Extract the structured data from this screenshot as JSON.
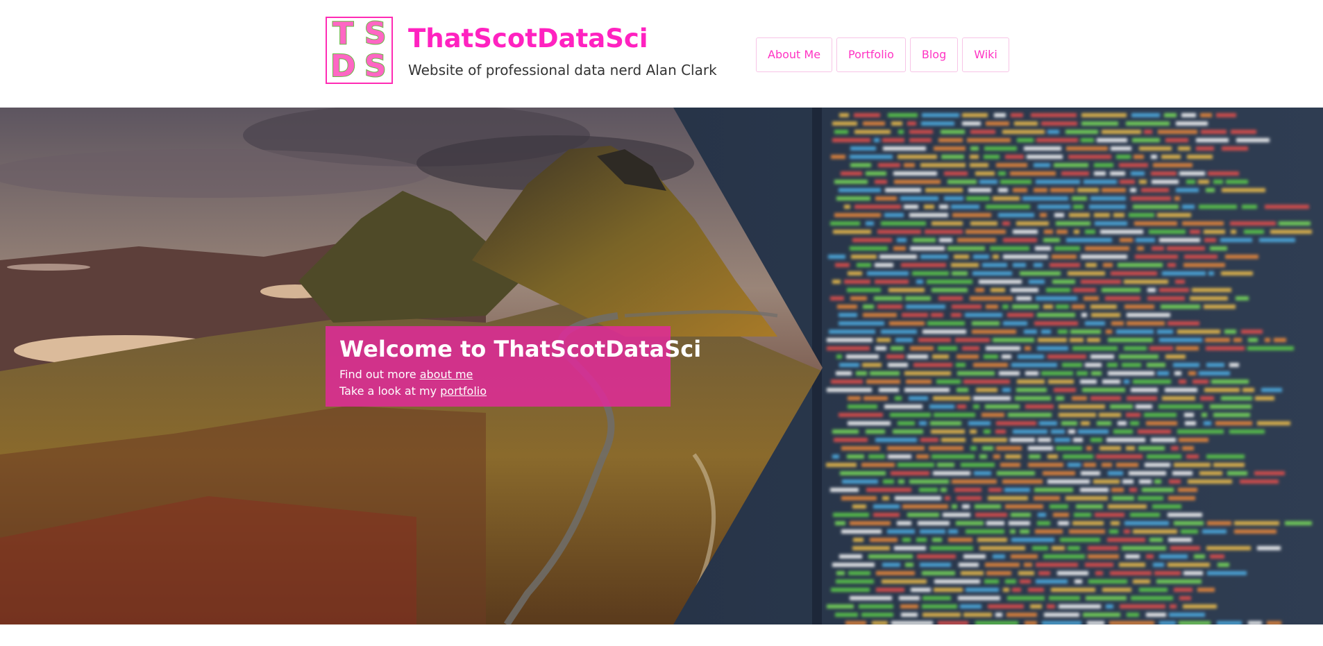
{
  "header": {
    "logo_letters": [
      "T",
      "S",
      "D",
      "S"
    ],
    "site_title": "ThatScotDataSci",
    "site_subtitle": "Website of professional data nerd Alan Clark"
  },
  "nav": {
    "items": [
      {
        "label": "About Me"
      },
      {
        "label": "Portfolio"
      },
      {
        "label": "Blog"
      },
      {
        "label": "Wiki"
      }
    ]
  },
  "hero": {
    "welcome_title": "Welcome to ThatScotDataSci",
    "line1_prefix": "Find out more ",
    "line1_link": "about me",
    "line2_prefix": "Take a look at my ",
    "line2_link": "portfolio"
  },
  "colors": {
    "brand_pink": "#ff22c0",
    "logo_green": "#66bb44",
    "welcome_bg": "#e4289e"
  }
}
